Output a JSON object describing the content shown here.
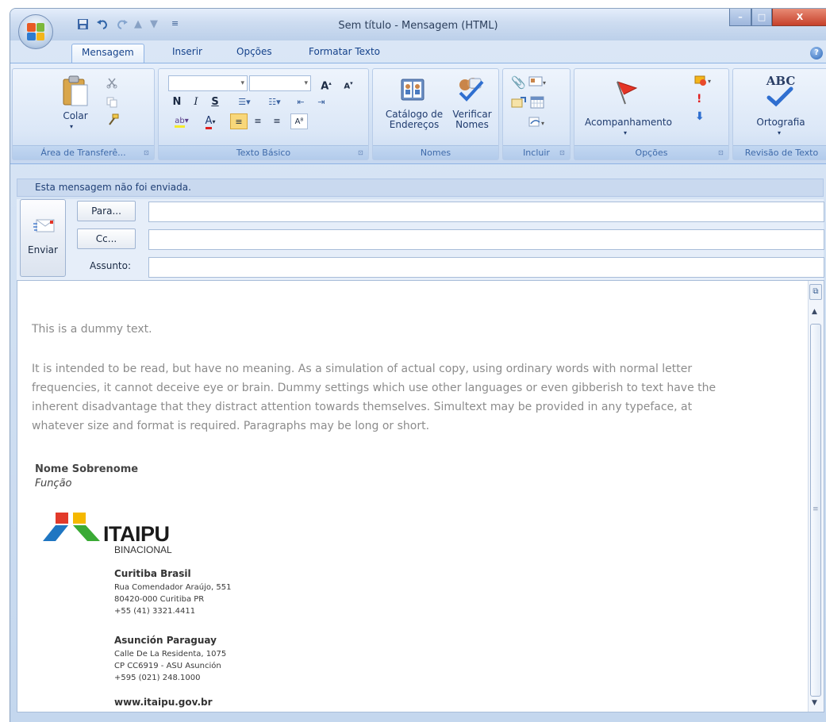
{
  "window": {
    "title": "Sem título - Mensagem (HTML)",
    "controls": {
      "minimize": "–",
      "maximize": "□",
      "close": "X"
    }
  },
  "quick_access": {
    "save_icon": "save-icon",
    "undo_icon": "undo-icon",
    "redo_icon": "redo-icon"
  },
  "tabs": [
    "Mensagem",
    "Inserir",
    "Opções",
    "Formatar Texto"
  ],
  "help_icon": "?",
  "ribbon": {
    "clipboard": {
      "paste": "Colar",
      "label": "Área de Transferê..."
    },
    "basic_text": {
      "bold": "N",
      "italic": "I",
      "underline": "S",
      "grow_font": "A",
      "shrink_font": "A",
      "label": "Texto Básico"
    },
    "names": {
      "address_book_l1": "Catálogo de",
      "address_book_l2": "Endereços",
      "check_names_l1": "Verificar",
      "check_names_l2": "Nomes",
      "label": "Nomes"
    },
    "include": {
      "label": "Incluir"
    },
    "options": {
      "follow_up": "Acompanhamento",
      "label": "Opções"
    },
    "proofing": {
      "spelling": "Ortografia",
      "abc": "ABC",
      "label": "Revisão de Texto"
    }
  },
  "info_bar": "Esta mensagem não foi enviada.",
  "header": {
    "send": "Enviar",
    "to_button": "Para...",
    "cc_button": "Cc...",
    "subject_label": "Assunto:",
    "to_value": "",
    "cc_value": "",
    "subject_value": ""
  },
  "body": {
    "line1": "This is a dummy text.",
    "paragraph": [
      "It is intended to be read, but have no meaning. As a simulation of actual copy, using ordinary words with normal letter",
      "frequencies, it cannot deceive eye or brain. Dummy settings which use other languages or even gibberish to text have the",
      "inherent disadvantage that they distract attention towards themselves. Simultext may be provided in any typeface, at",
      "whatever size and format is required. Paragraphs may be long or short."
    ],
    "signature": {
      "name": "Nome Sobrenome",
      "role": "Função",
      "logo_name": "ITAIPU",
      "logo_sub": "BINACIONAL",
      "office1": {
        "city": "Curitiba  Brasil",
        "line1": "Rua Comendador Araújo, 551",
        "line2": "80420-000  Curitiba  PR",
        "line3": "+55 (41) 3321.4411"
      },
      "office2": {
        "city": "Asunción  Paraguay",
        "line1": "Calle De La Residenta, 1075",
        "line2": "CP CC6919 - ASU  Asunción",
        "line3": "+595 (021) 248.1000"
      },
      "website": "www.itaipu.gov.br"
    }
  },
  "colors": {
    "ribbon_text": "#15428b",
    "logo_red": "#e23a2a",
    "logo_yellow": "#f5b800",
    "logo_blue": "#1f76c2",
    "logo_green": "#3aaa35"
  }
}
